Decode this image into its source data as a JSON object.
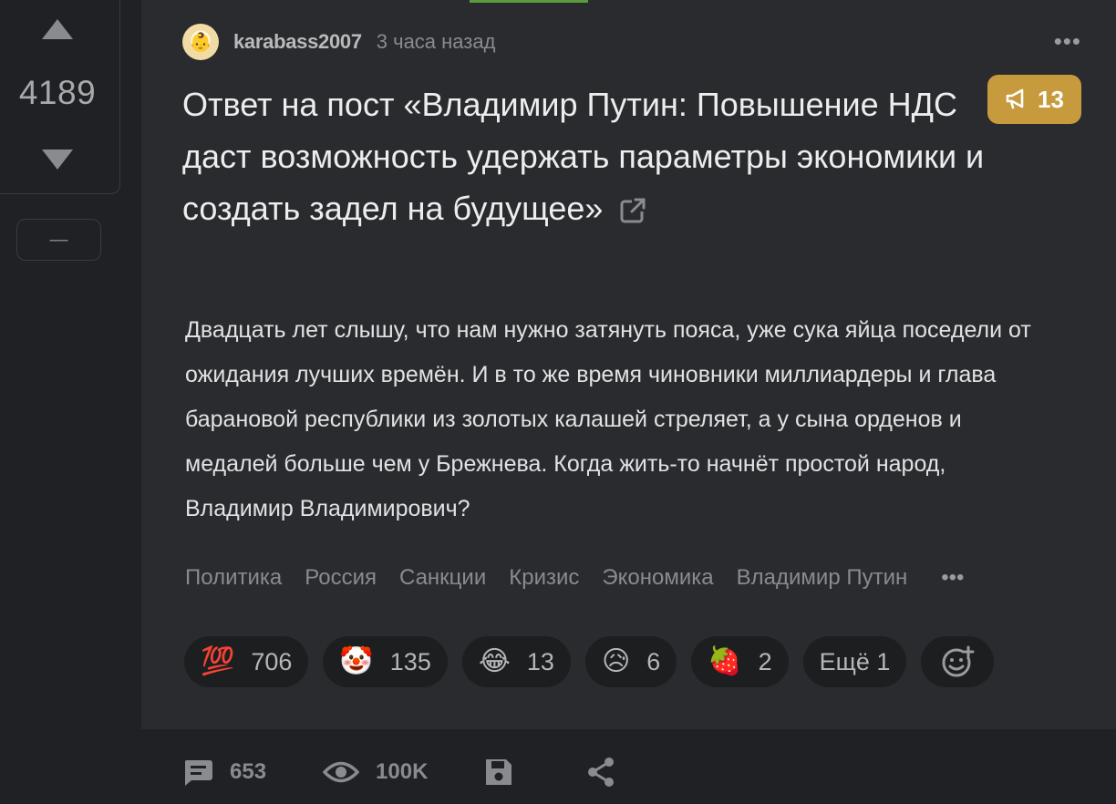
{
  "rating": {
    "value": "4189",
    "collapse_label": "—"
  },
  "author": {
    "name": "karabass2007",
    "time": "3 часа назад",
    "avatar_emoji": "👶"
  },
  "post": {
    "title": "Ответ на пост «Владимир Путин: Повышение НДС даст возможность удержать параметры экономики и создать задел на будущее»",
    "body": "Двадцать лет слышу, что нам нужно затянуть пояса, уже сука яйца поседели от ожидания лучших времён. И в то же время чиновники миллиардеры и глава барановой республики из золотых калашей стреляет, а у сына орденов и медалей больше чем у Брежнева. Когда жить-то начнёт простой народ, Владимир Владимирович?",
    "more_dots": "•••"
  },
  "badge": {
    "count": "13",
    "icon": "megaphone-icon"
  },
  "tags": {
    "items": [
      "Политика",
      "Россия",
      "Санкции",
      "Кризис",
      "Экономика",
      "Владимир Путин"
    ],
    "more": "•••"
  },
  "reactions": [
    {
      "emoji": "💯",
      "count": "706"
    },
    {
      "emoji": "🤡",
      "count": "135"
    },
    {
      "emoji": "😂",
      "count": "13"
    },
    {
      "emoji": "😥",
      "count": "6"
    },
    {
      "emoji": "🍓",
      "count": "2"
    }
  ],
  "reactions_more": "Ещё 1",
  "footer": {
    "comments": "653",
    "views": "100K"
  },
  "colors": {
    "background": "#202124",
    "card": "#2a2b2e",
    "badge": "#c79a3e",
    "accent_bar": "#5c9b3b"
  }
}
